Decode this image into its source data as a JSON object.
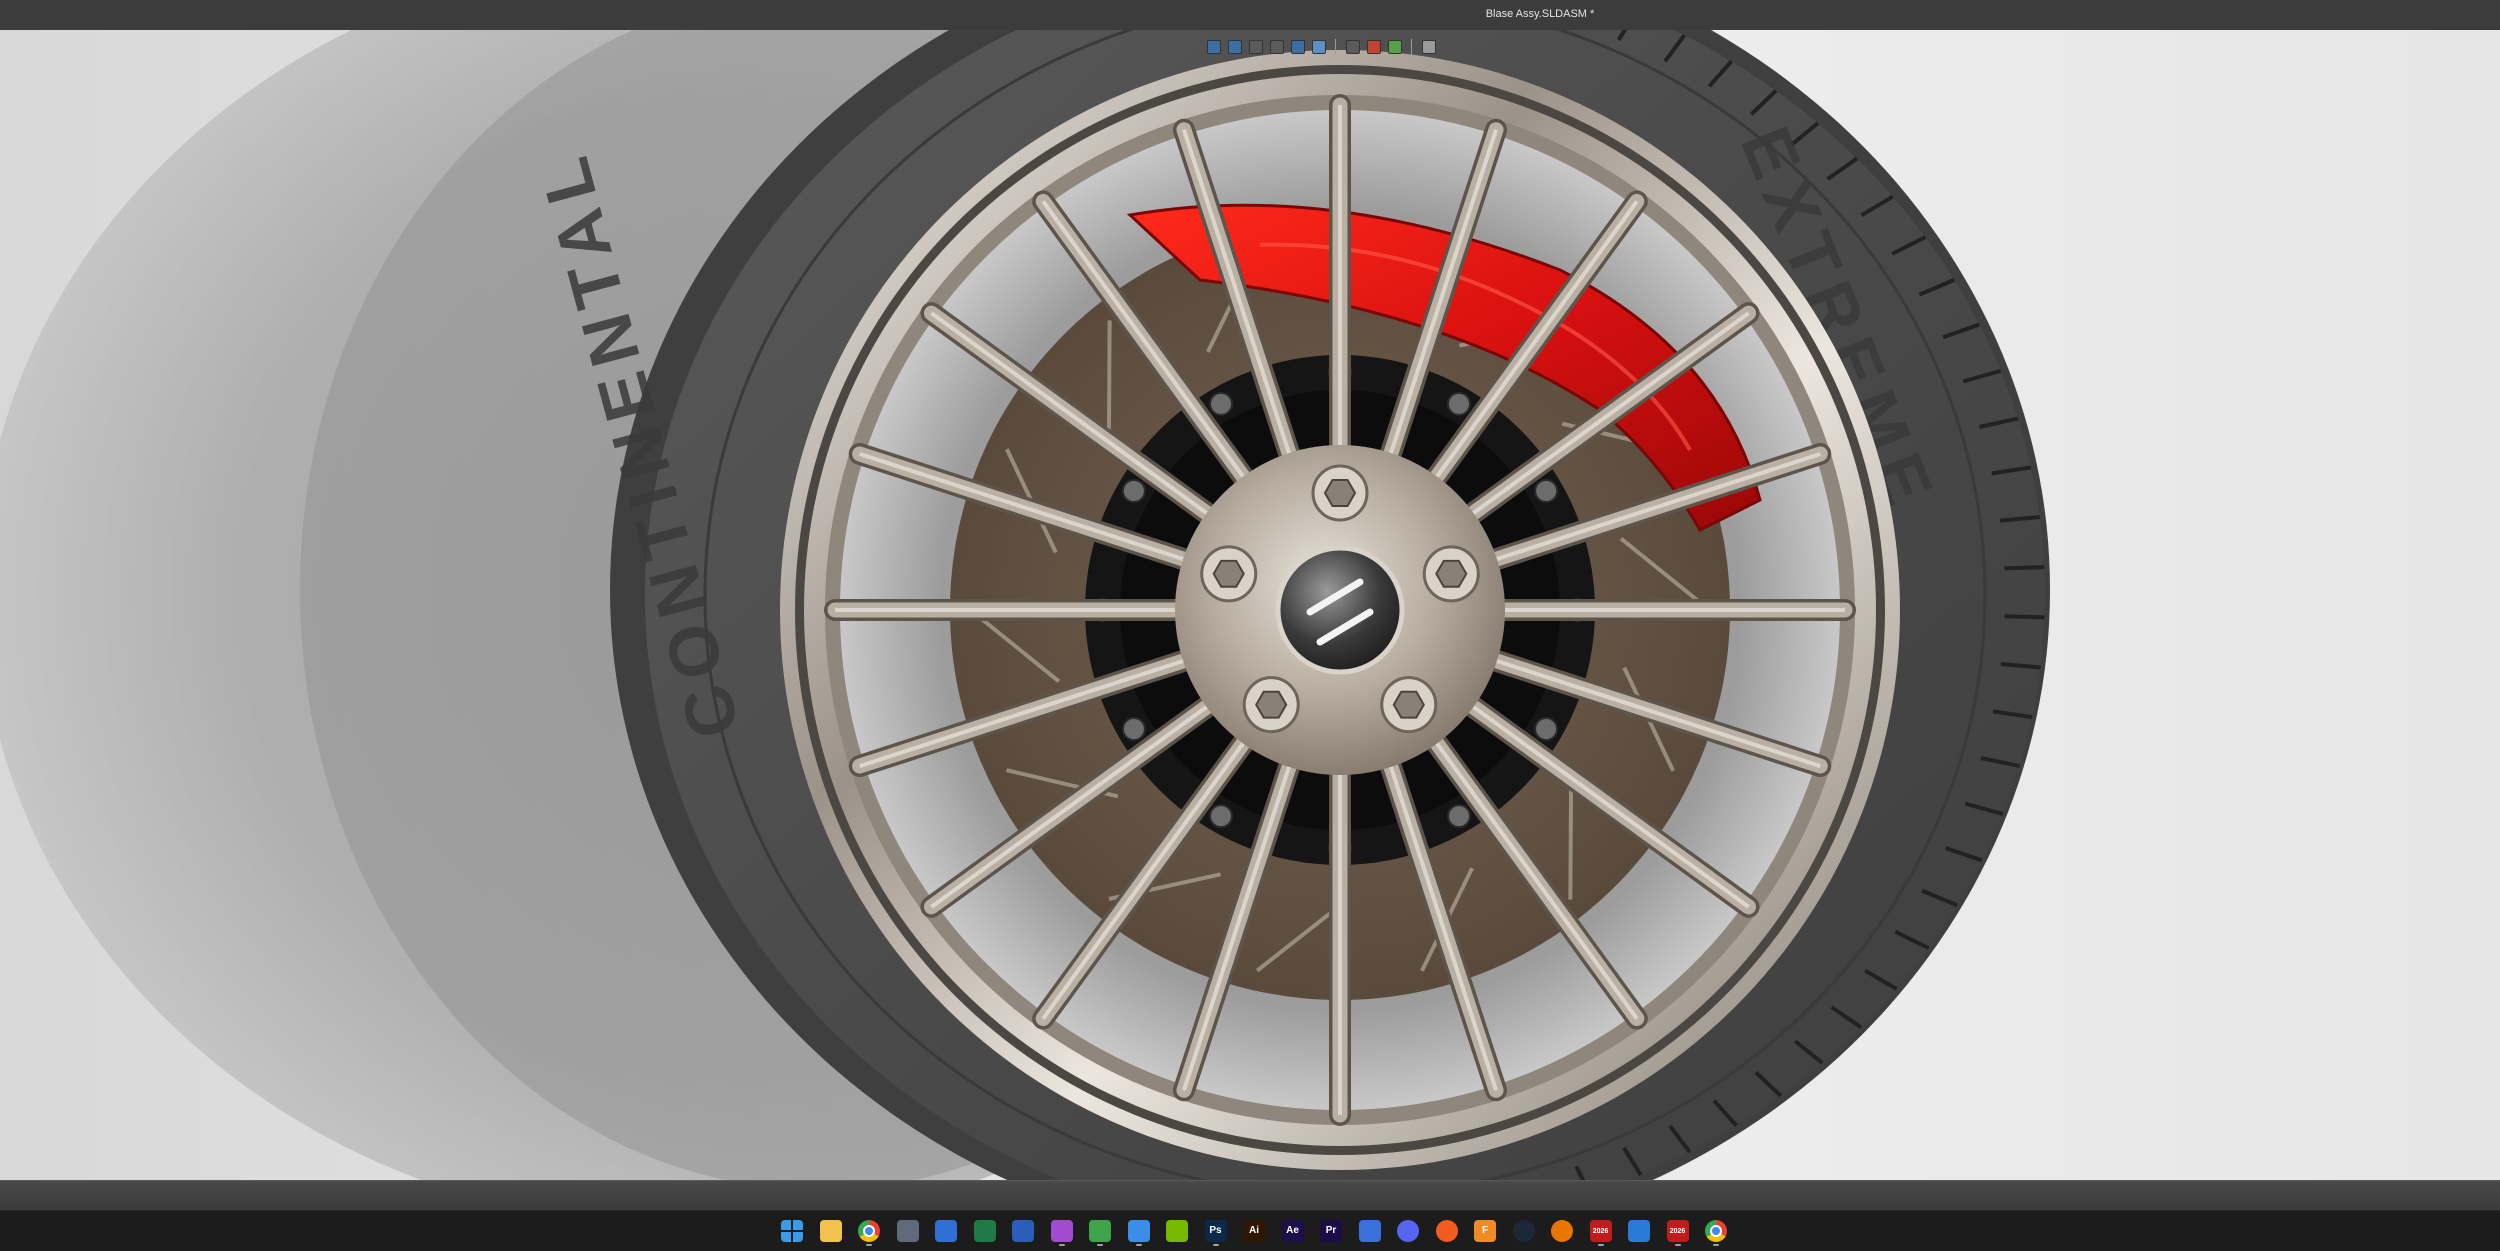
{
  "window": {
    "title": "Blase Assy.SLDASM *"
  },
  "viewport": {
    "scene": "wheel-assembly",
    "tire_sidewall_brand": "CONTINENTAL",
    "tire_sidewall_model": "EXTREME",
    "colors": {
      "caliper": "#d81010",
      "rim": "#a89f93",
      "disc": "#5e5043",
      "tire": "#4b4b4b",
      "hub_black": "#111111",
      "background": "#e2e2e2"
    },
    "hud_tools": [
      {
        "name": "zoom-to-fit-icon",
        "color": "#3d6ea5"
      },
      {
        "name": "zoom-to-area-icon",
        "color": "#3d6ea5"
      },
      {
        "name": "previous-view-icon",
        "color": "#5b5b5b"
      },
      {
        "name": "section-view-icon",
        "color": "#5b5b5b"
      },
      {
        "name": "view-orientation-icon",
        "color": "#3d6ea5"
      },
      {
        "name": "display-style-icon",
        "color": "#5e8fc4"
      },
      {
        "name": "hide-show-items-icon",
        "color": "#5b5b5b"
      },
      {
        "name": "edit-appearance-icon",
        "color": "#c2462f"
      },
      {
        "name": "apply-scene-icon",
        "color": "#58a04a"
      },
      {
        "name": "view-settings-icon",
        "color": "#9a9a9a"
      }
    ]
  },
  "taskbar": {
    "apps": [
      {
        "name": "windows-start-icon",
        "label": "",
        "color": "#3c9be8",
        "active": false
      },
      {
        "name": "file-explorer-icon",
        "label": "",
        "color": "#f2c14e",
        "active": false
      },
      {
        "name": "chrome-icon",
        "label": "",
        "color": "#e94235",
        "active": true
      },
      {
        "name": "calculator-icon",
        "label": "",
        "color": "#5f6b7a",
        "active": false
      },
      {
        "name": "store-icon",
        "label": "",
        "color": "#2f6fd6",
        "active": false
      },
      {
        "name": "excel-icon",
        "label": "",
        "color": "#1f7a43",
        "active": false
      },
      {
        "name": "word-icon",
        "label": "",
        "color": "#2b5eb8",
        "active": false
      },
      {
        "name": "camera-app-icon",
        "label": "",
        "color": "#a14bd1",
        "active": true
      },
      {
        "name": "xbox-icon",
        "label": "",
        "color": "#3fa44c",
        "active": true
      },
      {
        "name": "phone-link-icon",
        "label": "",
        "color": "#3a8ee6",
        "active": true
      },
      {
        "name": "nvidia-icon",
        "label": "",
        "color": "#76b900",
        "active": false
      },
      {
        "name": "photoshop-icon",
        "label": "Ps",
        "color": "#0b2a49",
        "active": true
      },
      {
        "name": "illustrator-icon",
        "label": "Ai",
        "color": "#2f1600",
        "active": false
      },
      {
        "name": "after-effects-icon",
        "label": "Ae",
        "color": "#1c0f4a",
        "active": false
      },
      {
        "name": "premiere-icon",
        "label": "Pr",
        "color": "#1b0e48",
        "active": false
      },
      {
        "name": "mail-icon",
        "label": "",
        "color": "#3b6fd9",
        "active": false
      },
      {
        "name": "discord-icon",
        "label": "",
        "color": "#5865f2",
        "active": false
      },
      {
        "name": "app-orange-icon",
        "label": "",
        "color": "#f25c21",
        "active": false
      },
      {
        "name": "fusion-icon",
        "label": "F",
        "color": "#f08a24",
        "active": false
      },
      {
        "name": "steam-icon",
        "label": "",
        "color": "#1b2838",
        "active": false
      },
      {
        "name": "blender-icon",
        "label": "",
        "color": "#ea7600",
        "active": false
      },
      {
        "name": "solidworks-2026-a-icon",
        "label": "2026",
        "color": "#c21b1b",
        "active": true
      },
      {
        "name": "cube-app-icon",
        "label": "",
        "color": "#2a7bd8",
        "active": false
      },
      {
        "name": "solidworks-2026-b-icon",
        "label": "2026",
        "color": "#c21b1b",
        "active": true
      },
      {
        "name": "chrome-alt-icon",
        "label": "",
        "color": "#e94235",
        "active": true
      }
    ]
  }
}
